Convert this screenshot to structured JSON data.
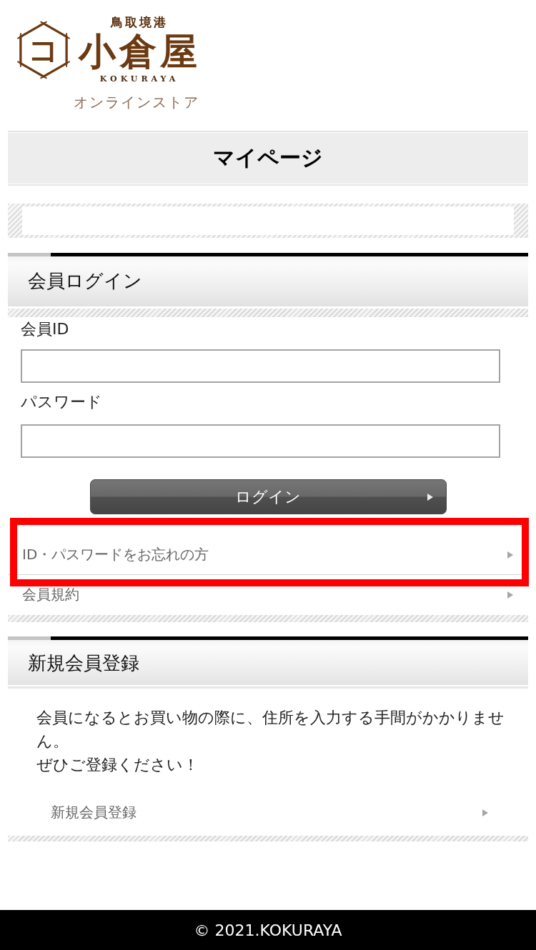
{
  "logo": {
    "emblem": "コ",
    "region": "鳥取境港",
    "name": "小倉屋",
    "romaji": "KOKURAYA",
    "subtitle": "オンラインストア"
  },
  "page_title": "マイページ",
  "login": {
    "heading": "会員ログイン",
    "fields": [
      {
        "label": "会員ID"
      },
      {
        "label": "パスワード"
      }
    ],
    "button": "ログイン",
    "links": [
      {
        "label": "ID・パスワードをお忘れの方",
        "highlighted": true
      },
      {
        "label": "会員規約",
        "highlighted": false
      }
    ]
  },
  "register": {
    "heading": "新規会員登録",
    "lines": [
      "会員になるとお買い物の際に、住所を入力する手間がかかりません。",
      "ぜひご登録ください！"
    ],
    "link": "新規会員登録"
  },
  "footer": "© 2021.KOKURAYA"
}
